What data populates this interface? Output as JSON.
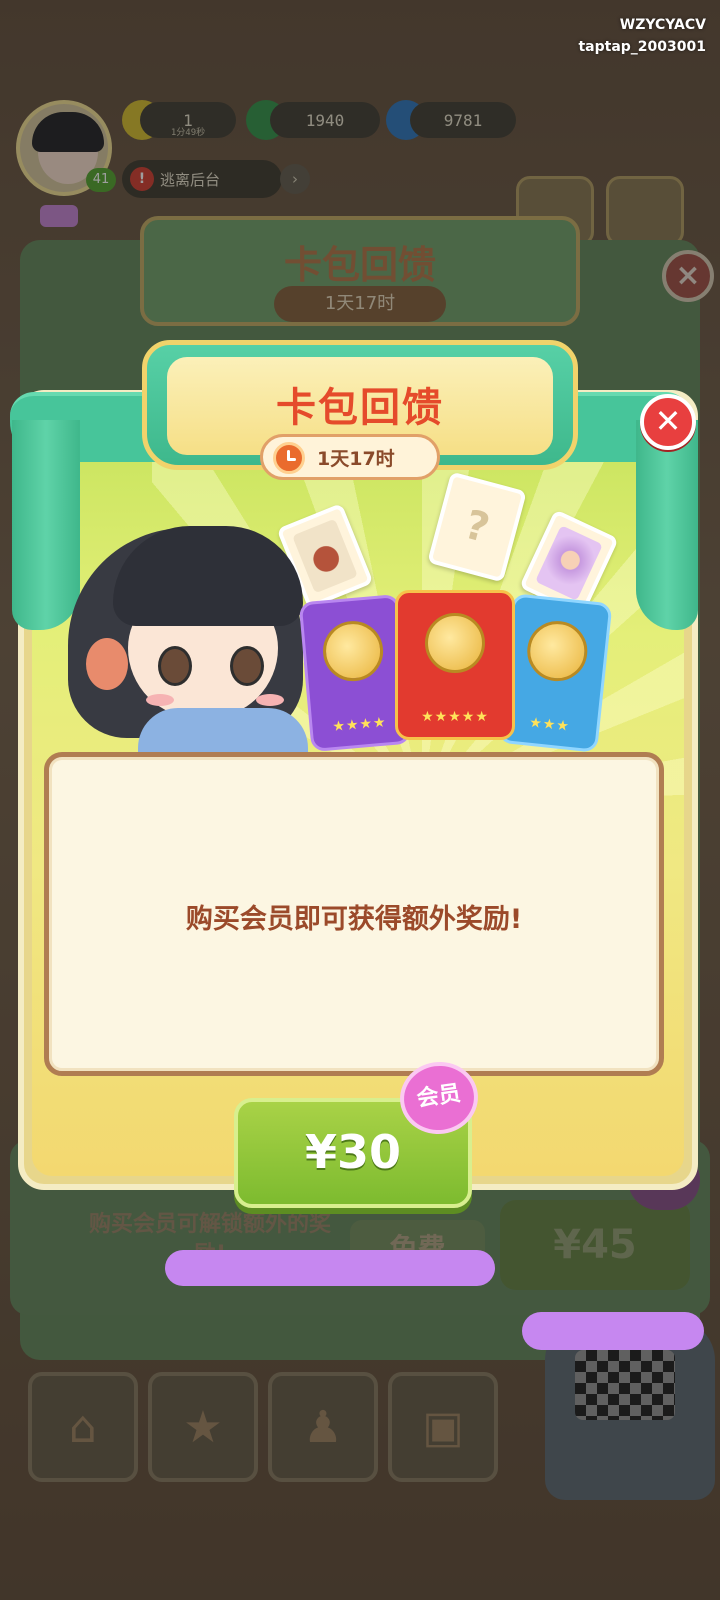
{
  "watermark": {
    "line1": "WZYCYACV",
    "line2": "taptap_2003001"
  },
  "hud": {
    "counter_1": "1",
    "counter_1_sub": "1分49秒",
    "gems": "1940",
    "fire": "9781",
    "level": "41",
    "escape_label": "逃离后台"
  },
  "back_panel": {
    "title": "卡包回馈",
    "timer": "1天17时",
    "note": "购买会员可解锁额外的奖励!",
    "free_label": "免费",
    "price_label": "¥45"
  },
  "popup": {
    "title": "卡包回馈",
    "timer": "1天17时",
    "message": "购买会员即可获得额外奖励!",
    "buy_label": "¥30",
    "vip_badge": "会员",
    "close_glyph": "✕",
    "card_question": "?"
  },
  "nav": {
    "items": [
      {
        "name": "home",
        "icon": "house-icon",
        "glyph": "⌂"
      },
      {
        "name": "book",
        "icon": "book-icon",
        "glyph": "★"
      },
      {
        "name": "stamp",
        "icon": "stamp-icon",
        "glyph": "♟"
      },
      {
        "name": "cards",
        "icon": "cards-icon",
        "glyph": "▣"
      }
    ]
  },
  "colors": {
    "title_red": "#e54b2b",
    "curtain_green": "#47c59a",
    "buy_green": "#7dbb2f",
    "vip_pink": "#ea6fd3",
    "close_red": "#e83f3f"
  }
}
